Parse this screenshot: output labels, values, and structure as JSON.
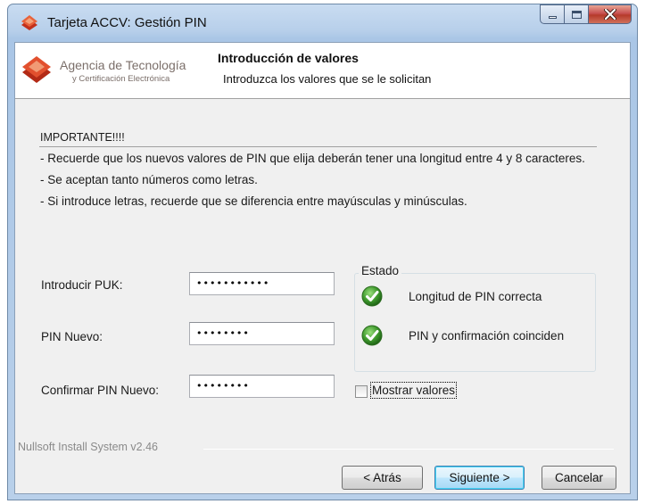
{
  "window": {
    "title": "Tarjeta ACCV: Gestión PIN",
    "controls": {
      "minimize": "minimize-icon",
      "maximize": "maximize-icon",
      "close": "close-icon"
    }
  },
  "header": {
    "logo_line1": "Agencia de Tecnología",
    "logo_line2": "y Certificación Electrónica",
    "title": "Introducción de valores",
    "subtitle": "Introduzca los valores que se le solicitan"
  },
  "notes": {
    "heading": "IMPORTANTE!!!!",
    "lines": [
      "- Recuerde que los nuevos valores de PIN que elija deberán tener una longitud entre 4 y 8 caracteres.",
      "- Se aceptan tanto números como letras.",
      "- Si introduce letras, recuerde que se diferencia entre mayúsculas y minúsculas."
    ]
  },
  "form": {
    "puk_label": "Introducir PUK:",
    "puk_value": "•••••••••••",
    "new_pin_label": "PIN Nuevo:",
    "new_pin_value": "••••••••",
    "confirm_pin_label": "Confirmar PIN Nuevo:",
    "confirm_pin_value": "••••••••"
  },
  "estado": {
    "legend": "Estado",
    "items": [
      {
        "text": "Longitud de PIN correcta",
        "icon": "check-icon"
      },
      {
        "text": "PIN y confirmación coinciden",
        "icon": "check-icon"
      }
    ]
  },
  "show_values": {
    "label": "Mostrar valores",
    "checked": false
  },
  "footer": {
    "branding": "Nullsoft Install System v2.46",
    "back": "< Atrás",
    "next": "Siguiente >",
    "cancel": "Cancelar"
  },
  "colors": {
    "accent": "#3c7fb1",
    "check_green": "#3f9a2d",
    "logo_orange": "#d4462a"
  }
}
